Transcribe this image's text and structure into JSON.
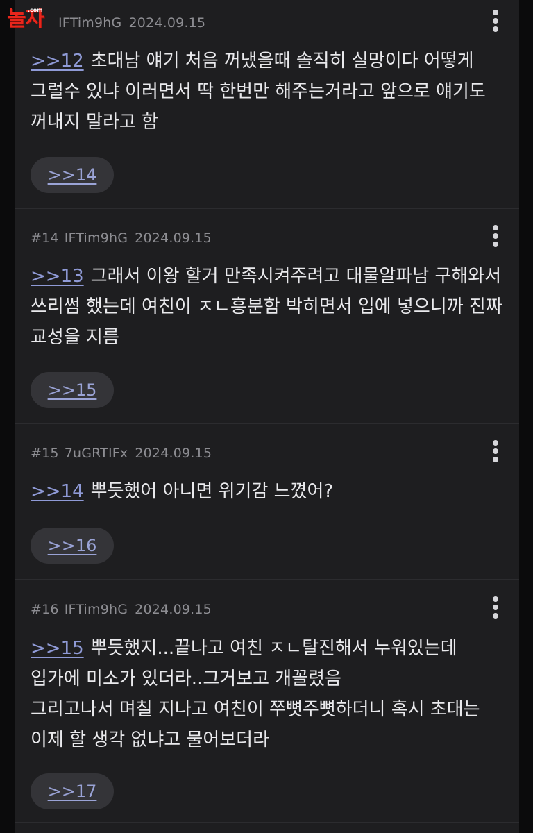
{
  "logo": {
    "text": "놀자",
    "suffix": ".com"
  },
  "posts": [
    {
      "number": "",
      "uid": "IFTim9hG",
      "date": "2024.09.15",
      "anchor": ">>12",
      "text": "초대남 얘기 처음 꺼냈을때 솔직히 실망이다 어떻게 그럴수 있냐 이러면서 딱 한번만 해주는거라고 앞으로 얘기도 꺼내지 말라고 함",
      "reply": ">>14"
    },
    {
      "number": "#14",
      "uid": "IFTim9hG",
      "date": "2024.09.15",
      "anchor": ">>13",
      "text": "그래서 이왕 할거 만족시켜주려고 대물알파남 구해와서 쓰리썸 했는데 여친이 ㅈㄴ흥분함 박히면서 입에 넣으니까 진짜 교성을 지름",
      "reply": ">>15"
    },
    {
      "number": "#15",
      "uid": "7uGRTIFx",
      "date": "2024.09.15",
      "anchor": ">>14",
      "text": "뿌듯했어 아니면 위기감 느꼈어?",
      "reply": ">>16"
    },
    {
      "number": "#16",
      "uid": "IFTim9hG",
      "date": "2024.09.15",
      "anchor": ">>15",
      "text": "뿌듯했지...끝나고 여친 ㅈㄴ탈진해서 누워있는데 입가에 미소가 있더라..그거보고 개꼴렸음\n그리고나서 며칠 지나고 여친이 쭈뼛주뼛하더니 혹시 초대는 이제 할 생각 없냐고 물어보더라",
      "reply": ">>17"
    }
  ]
}
